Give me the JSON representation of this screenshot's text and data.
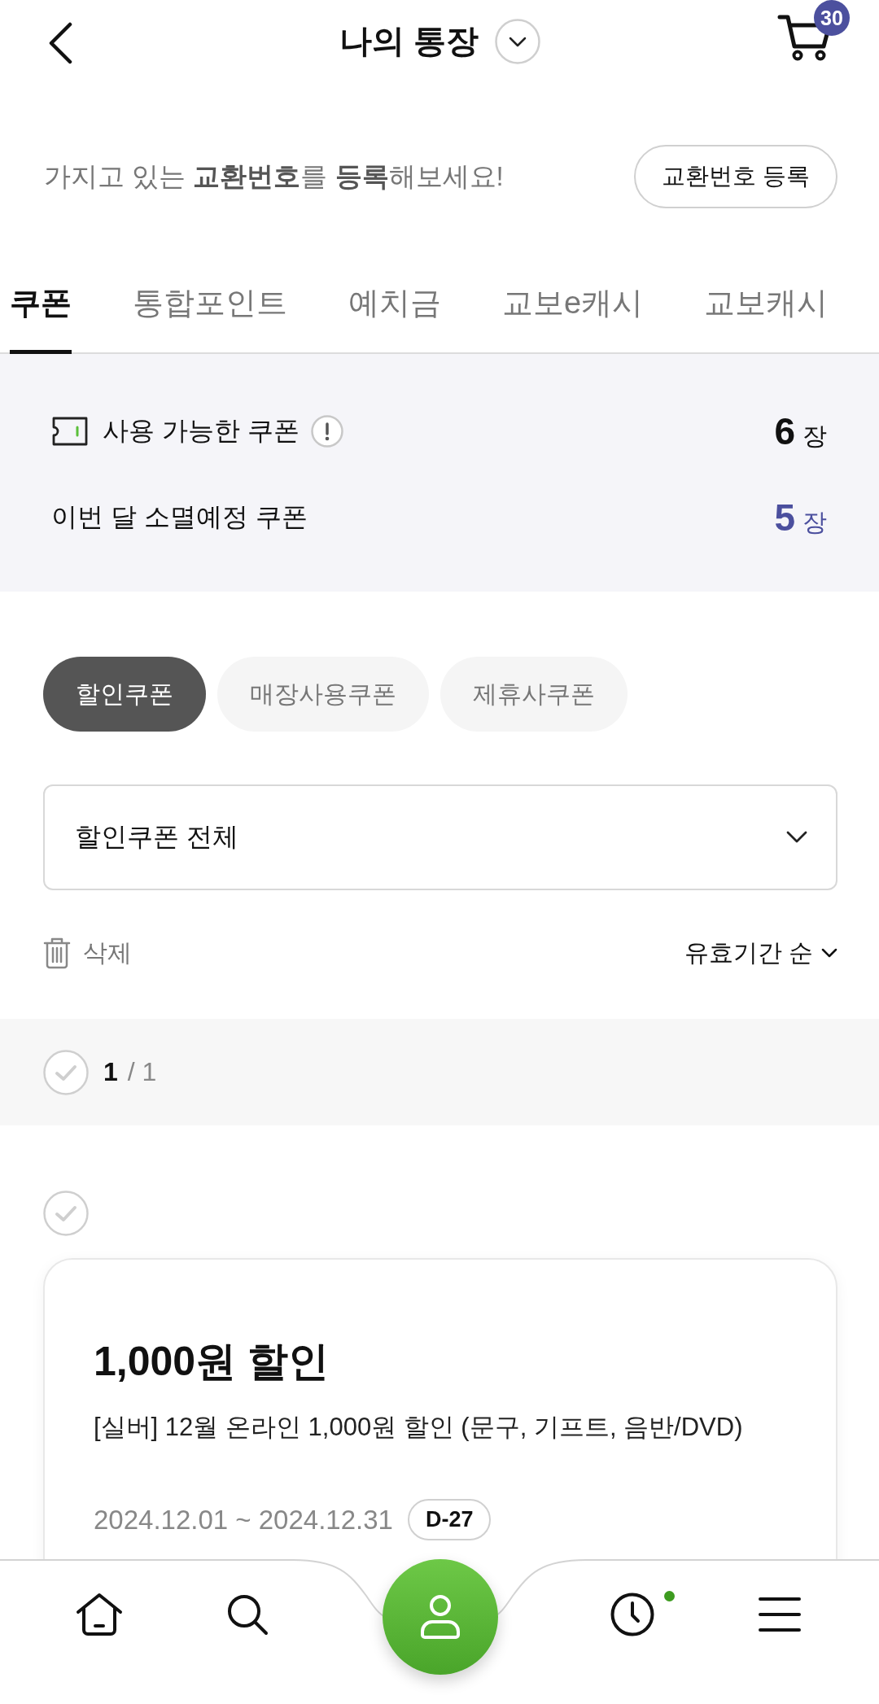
{
  "header": {
    "title": "나의 통장",
    "cart_count": "30"
  },
  "register_banner": {
    "message": "가지고 있는 **교환번호**를 **등록**해보세요!",
    "button": "교환번호 등록"
  },
  "tabs": [
    {
      "label": "쿠폰",
      "selected": true
    },
    {
      "label": "통합포인트",
      "selected": false
    },
    {
      "label": "예치금",
      "selected": false
    },
    {
      "label": "교보e캐시",
      "selected": false
    },
    {
      "label": "교보캐시",
      "selected": false
    }
  ],
  "summary": [
    {
      "kind": "available",
      "label": "사용 가능한 쿠폰",
      "count": "6",
      "unit": "장"
    },
    {
      "kind": "expiring",
      "label": "이번 달 소멸예정 쿠폰",
      "count": "5",
      "unit": "장"
    }
  ],
  "chips": [
    {
      "label": "할인쿠폰",
      "selected": true
    },
    {
      "label": "매장사용쿠폰",
      "selected": false
    },
    {
      "label": "제휴사쿠폰",
      "selected": false
    }
  ],
  "filter": {
    "value": "할인쿠폰 전체"
  },
  "toolbar": {
    "delete": "삭제",
    "sort": "유효기간 순"
  },
  "select_all": {
    "checked": false,
    "selected_count": "1",
    "total": "/ 1"
  },
  "coupons": [
    {
      "checked": false,
      "title": "1,000원 할인",
      "description": "[실버] 12월 온라인 1,000원 할인 (문구, 기프트, 음반/DVD)",
      "period": "2024.12.01 ~ 2024.12.31",
      "d_day": "D-27"
    }
  ],
  "bottom_nav": [
    {
      "kind": "home",
      "dot": false
    },
    {
      "kind": "search",
      "dot": false
    },
    {
      "kind": "profile",
      "dot": false
    },
    {
      "kind": "recent",
      "dot": true
    },
    {
      "kind": "menu",
      "dot": false
    }
  ]
}
